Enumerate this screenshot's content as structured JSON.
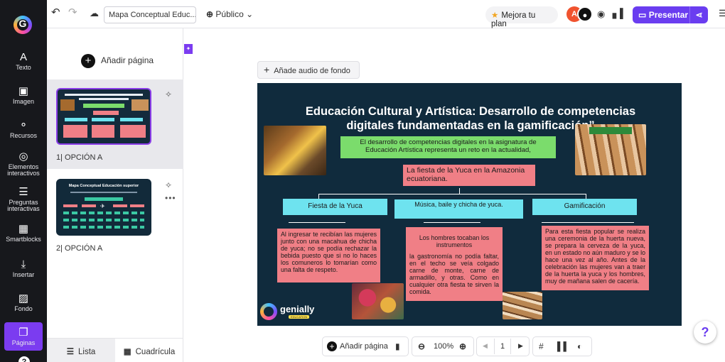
{
  "rail": {
    "logo_letter": "G",
    "items": [
      {
        "icon": "A",
        "label": "Texto"
      },
      {
        "icon": "▣",
        "label": "Imagen"
      },
      {
        "icon": "⚬",
        "label": "Recursos"
      },
      {
        "icon": "◎",
        "label": "Elementos interactivos"
      },
      {
        "icon": "☰",
        "label": "Preguntas interactivas"
      },
      {
        "icon": "▦",
        "label": "Smartblocks"
      },
      {
        "icon": "⤓",
        "label": "Insertar"
      },
      {
        "icon": "▨",
        "label": "Fondo"
      },
      {
        "icon": "❐",
        "label": "Páginas"
      }
    ],
    "help": "?"
  },
  "topbar": {
    "undo": "↶",
    "redo": "↷",
    "cloud_icon": "☁",
    "title": "Mapa Conceptual Educ...",
    "visibility": "Público",
    "improve": "Mejora tu plan",
    "avatars": [
      "A",
      "●"
    ],
    "present": "Presentar",
    "menu": "☰"
  },
  "panel": {
    "add_page": "Añadir página",
    "pages": [
      {
        "label": "1| OPCIÓN A",
        "selected": true
      },
      {
        "label": "2| OPCIÓN A",
        "selected": false
      }
    ],
    "thumb2_title": "Mapa Conceptual Educación superior",
    "view_list": "Lista",
    "view_grid": "Cuadrícula"
  },
  "canvas": {
    "audio": "Añade audio de fondo"
  },
  "slide": {
    "title": "Educación Cultural y Artística: Desarrollo de competencias digitales fundamentadas en la gamificación”",
    "intro": "El desarrollo de competencias digitales en la asignatura de Educación Artística representa un reto en la actualidad,",
    "fiesta": "La fiesta de la Yuca en la Amazonia ecuatoriana.",
    "branches": [
      {
        "title": "Fiesta de la Yuca",
        "text": "Al ingresar te recibían las mujeres junto con una macahua de chicha de yuca; no se podía rechazar la bebida puesto que si no lo haces los comuneros lo tomarían como una falta de respeto."
      },
      {
        "title": "Música, baile y chicha de yuca.",
        "subtitle": "Los hombres tocaban los instrumentos",
        "text": "la gastronomía no podía faltar, en el techo se veía colgado carne de monte, carne de armadillo, y otras. Como en cualquier otra fiesta te sirven la comida."
      },
      {
        "title": "Gamificación",
        "text": "Para esta fiesta popular se realiza una ceremonia de la huerta nueva, se prepara la cerveza de la yuca, en un estado no aún maduro y se lo hace una vez al año. Antes de la celebración las mujeres van a traer de la huerta la yuca y los hombres, muy de mañana salen de cacería."
      }
    ],
    "logo_text": "genially",
    "logo_sub": "EDUCATION"
  },
  "bottom": {
    "add_page": "Añadir página",
    "zoom": "100%",
    "page_number": "1"
  },
  "colors": {
    "accent": "#6a3df0",
    "slide_bg": "#102b3d",
    "green_box": "#7bdc6c",
    "pink_box": "#f07f86",
    "cyan_box": "#6ee3ef"
  }
}
